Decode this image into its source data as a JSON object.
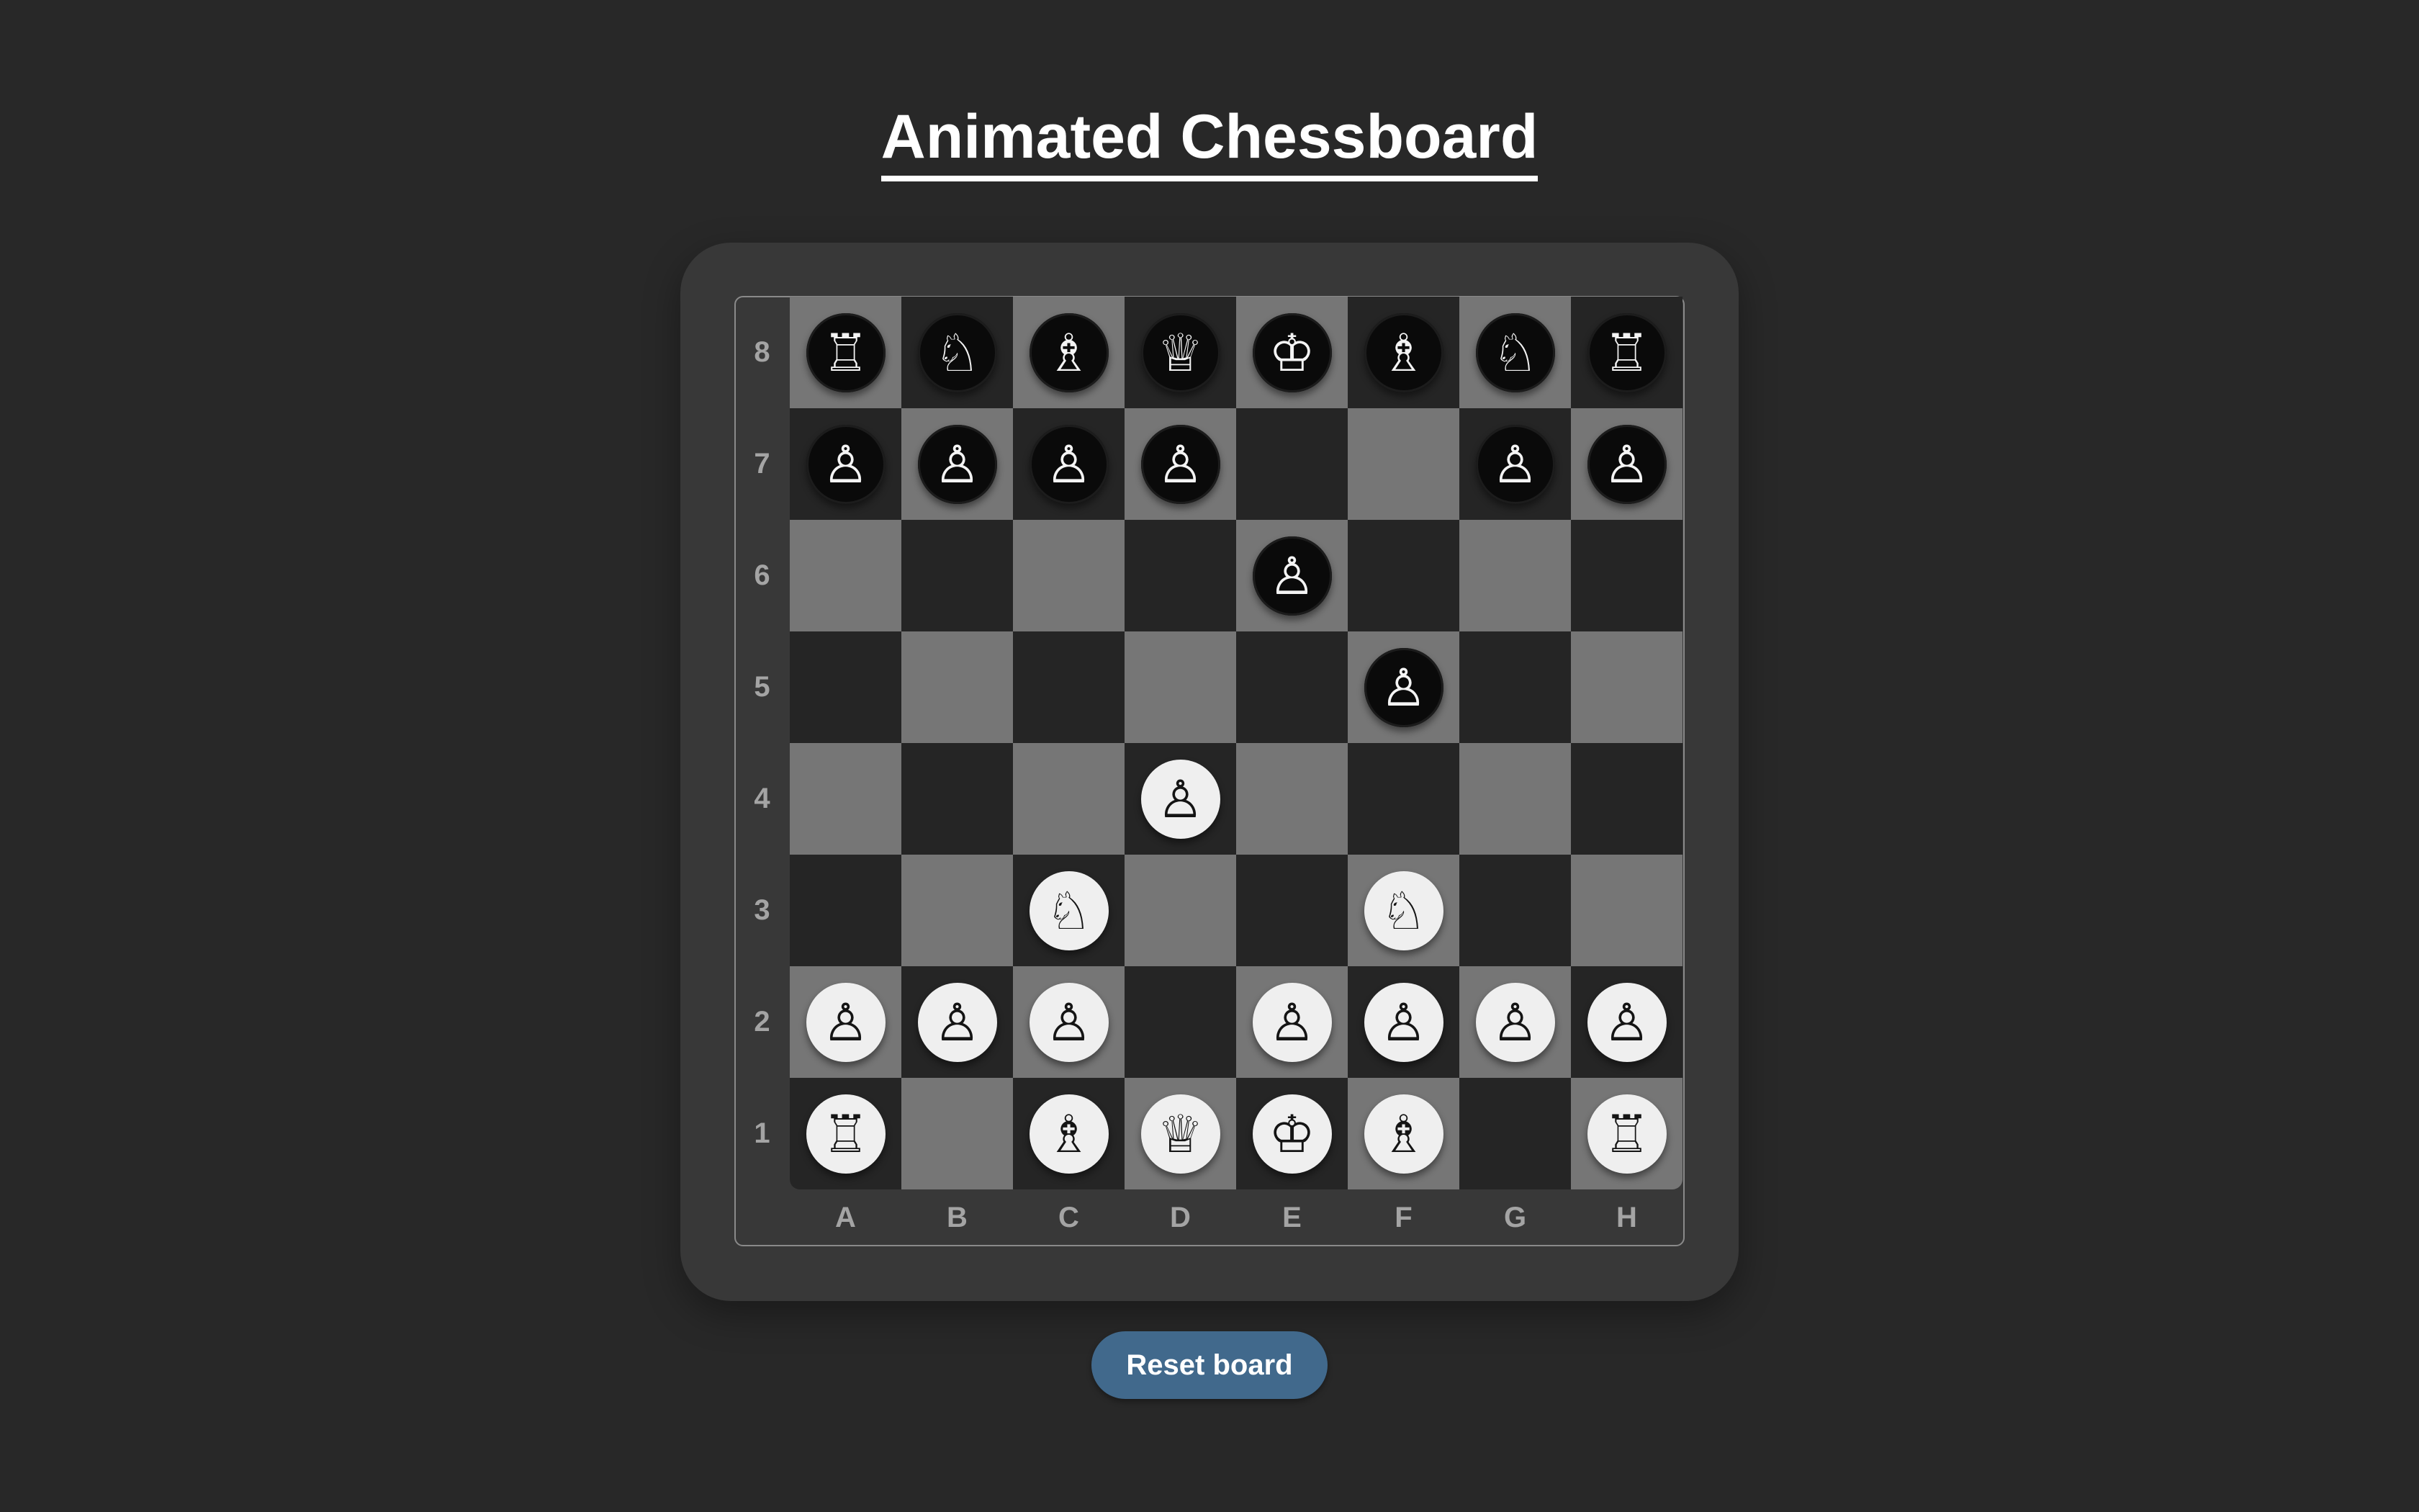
{
  "title": "Animated Chessboard",
  "ranks": [
    "8",
    "7",
    "6",
    "5",
    "4",
    "3",
    "2",
    "1"
  ],
  "files": [
    "A",
    "B",
    "C",
    "D",
    "E",
    "F",
    "G",
    "H"
  ],
  "board": [
    [
      "br",
      "bn",
      "bb",
      "bq",
      "bk",
      "bb",
      "bn",
      "br"
    ],
    [
      "bp",
      "bp",
      "bp",
      "bp",
      "",
      "",
      "bp",
      "bp"
    ],
    [
      "",
      "",
      "",
      "",
      "bp",
      "",
      "",
      ""
    ],
    [
      "",
      "",
      "",
      "",
      "",
      "bp",
      "",
      ""
    ],
    [
      "",
      "",
      "",
      "wp",
      "",
      "",
      "",
      ""
    ],
    [
      "",
      "",
      "wn",
      "",
      "",
      "wn",
      "",
      ""
    ],
    [
      "wp",
      "wp",
      "wp",
      "",
      "wp",
      "wp",
      "wp",
      "wp"
    ],
    [
      "wr",
      "",
      "wb",
      "wq",
      "wk",
      "wb",
      "",
      "wr"
    ]
  ],
  "piece_names": {
    "r": "rook",
    "n": "knight",
    "b": "bishop",
    "q": "queen",
    "k": "king",
    "p": "pawn"
  },
  "glyphs": {
    "r": "♖",
    "n": "♘",
    "b": "♗",
    "q": "♕",
    "k": "♔",
    "p": "♙"
  },
  "colors": {
    "page_background": "#282828",
    "panel": "#383838",
    "light_square": "#767676",
    "dark_square": "#252525",
    "black_piece": "#0a0a0a",
    "white_piece": "#efefef",
    "button": "#41698c",
    "label": "#a4a4a4"
  },
  "reset_button": {
    "label": "Reset board"
  }
}
